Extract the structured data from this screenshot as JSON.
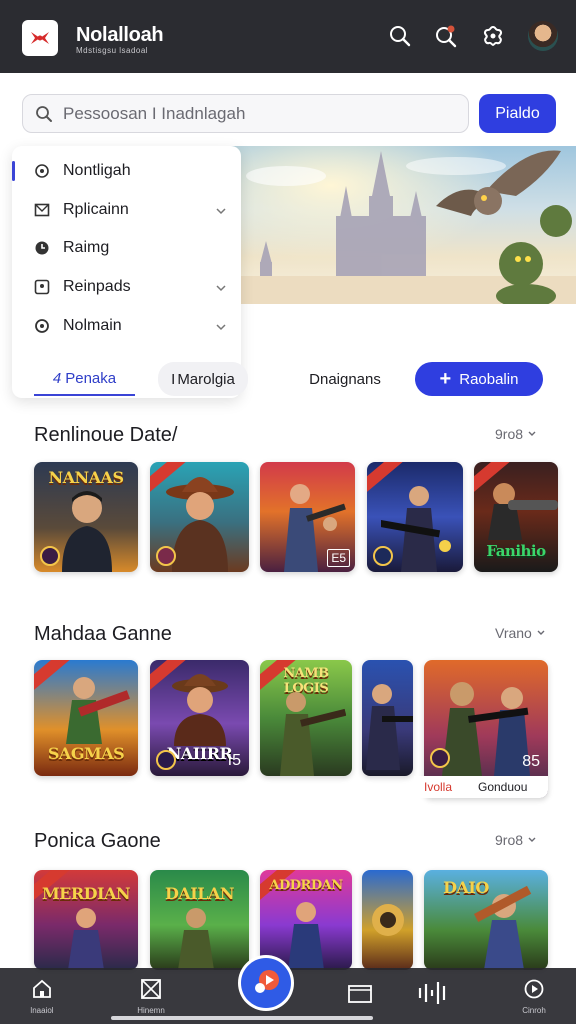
{
  "app": {
    "title": "Nolalloah",
    "subtitle": "Mdstisgsu lsadoal"
  },
  "header": {
    "icons": [
      "search-icon",
      "search-alert-icon",
      "settings-icon",
      "user-avatar"
    ]
  },
  "search": {
    "placeholder": "Pessoosan I Inadnlagah",
    "button_label": "Pialdo"
  },
  "menu": {
    "items": [
      {
        "label": "Nontligah",
        "icon": "globe-icon",
        "has_chevron": false,
        "active": true
      },
      {
        "label": "Rplicainn",
        "icon": "mail-icon",
        "has_chevron": true,
        "active": false
      },
      {
        "label": "Raimg",
        "icon": "clock-icon",
        "has_chevron": false,
        "active": false
      },
      {
        "label": "Reinpads",
        "icon": "chat-icon",
        "has_chevron": true,
        "active": false
      },
      {
        "label": "Nolmain",
        "icon": "search-icon",
        "has_chevron": true,
        "active": false
      }
    ]
  },
  "tabs": [
    {
      "label": "Penaka",
      "prefix": "4"
    },
    {
      "label": "Marolgia",
      "prefix": "I"
    },
    {
      "label": "Dnaignans"
    },
    {
      "label": "Raobalin",
      "prefix": "+"
    }
  ],
  "sections": [
    {
      "title": "Renlinoue Date/",
      "more_label": "9ro8",
      "cards": [
        {
          "art_title": "NANAAS",
          "badge": ""
        },
        {
          "art_title": "",
          "badge": ""
        },
        {
          "art_title": "",
          "badge": "E5"
        },
        {
          "art_title": "",
          "badge": ""
        },
        {
          "art_title": "Fanihio",
          "badge": ""
        }
      ]
    },
    {
      "title": "Mahdaa Ganne",
      "more_label": "Vrano",
      "cards": [
        {
          "art_title": "SAGMAS",
          "badge": ""
        },
        {
          "art_title": "NAIIRR",
          "badge": "I5"
        },
        {
          "art_title": "NAMB LOGIS",
          "badge": ""
        },
        {
          "art_title": "",
          "badge": ""
        },
        {
          "art_title": "",
          "badge": "85"
        }
      ],
      "feature_caption": {
        "left": "Ivolla",
        "right": "Gonduou"
      }
    },
    {
      "title": "Ponica Gaone",
      "more_label": "9ro8",
      "cards": [
        {
          "art_title": "MERDIAN",
          "badge": ""
        },
        {
          "art_title": "DAILAN",
          "badge": ""
        },
        {
          "art_title": "ADDRDAN",
          "badge": ""
        },
        {
          "art_title": "",
          "badge": ""
        },
        {
          "art_title": "DAIO",
          "badge": ""
        }
      ]
    }
  ],
  "bottom_nav": [
    {
      "label": "lnaaiol",
      "icon": "home-icon"
    },
    {
      "label": "Hinemn",
      "icon": "box-icon"
    },
    {
      "label": "",
      "icon": "play-icon"
    },
    {
      "label": "",
      "icon": "window-icon"
    },
    {
      "label": "",
      "icon": "soundwave-icon"
    },
    {
      "label": "Cinroh",
      "icon": "chat-icon"
    }
  ],
  "colors": {
    "accent": "#2f3ee0",
    "topbar": "#2b2c31",
    "ribbon": "#d63a2f"
  }
}
